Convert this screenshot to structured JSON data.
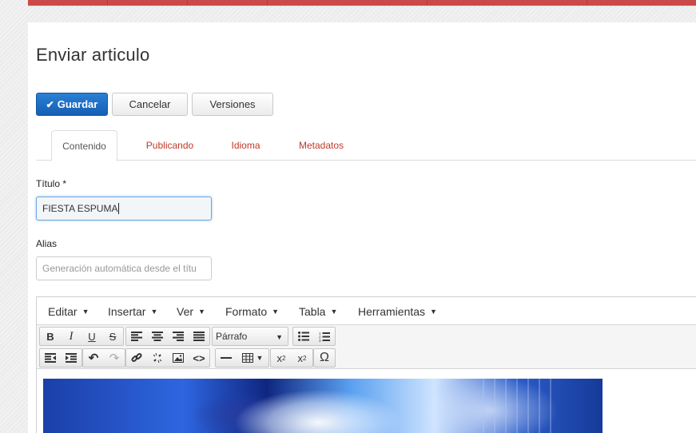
{
  "page": {
    "title": "Enviar articulo"
  },
  "actions": {
    "save": "Guardar",
    "cancel": "Cancelar",
    "versions": "Versiones"
  },
  "tabs": [
    {
      "label": "Contenido",
      "active": true
    },
    {
      "label": "Publicando",
      "active": false
    },
    {
      "label": "Idioma",
      "active": false
    },
    {
      "label": "Metadatos",
      "active": false
    }
  ],
  "form": {
    "title_label": "Título *",
    "title_value": "FIESTA ESPUMA",
    "alias_label": "Alias",
    "alias_placeholder": "Generación automática desde el títu"
  },
  "editor": {
    "menus": [
      "Editar",
      "Insertar",
      "Ver",
      "Formato",
      "Tabla",
      "Herramientas"
    ],
    "format_select": "Párrafo",
    "toolbar_row1": [
      "bold-icon",
      "italic-icon",
      "underline-icon",
      "strikethrough-icon",
      "align-left-icon",
      "align-center-icon",
      "align-right-icon",
      "align-justify-icon",
      "bullet-list-icon",
      "numbered-list-icon"
    ],
    "toolbar_row2": [
      "outdent-icon",
      "indent-icon",
      "undo-icon",
      "redo-icon",
      "link-icon",
      "unlink-icon",
      "image-icon",
      "code-icon",
      "horizontal-rule-icon",
      "table-icon",
      "subscript-icon",
      "superscript-icon",
      "special-char-icon"
    ]
  },
  "colors": {
    "accent": "#c94a49",
    "primary_button": "#1a6fc9",
    "tab_link": "#c0392b"
  }
}
